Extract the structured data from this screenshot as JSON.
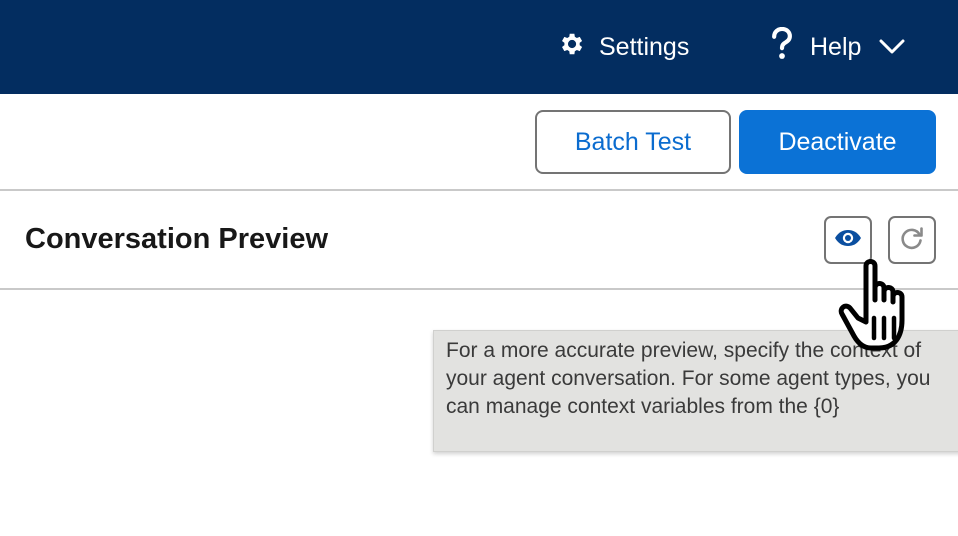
{
  "topbar": {
    "settings_icon": "gear-icon",
    "settings_label": "Settings",
    "help_icon": "question-icon",
    "help_label": "Help",
    "help_menu_icon": "chevron-down-icon"
  },
  "actions": {
    "batch_test_label": "Batch Test",
    "deactivate_label": "Deactivate"
  },
  "preview": {
    "title": "Conversation Preview",
    "context_icon": "eye-icon",
    "refresh_icon": "refresh-icon"
  },
  "tooltip": {
    "text": "For a more accurate preview, specify the context of your agent conversation. For some agent types, you can manage context variables from the {0}"
  },
  "colors": {
    "topbar_bg": "#032d60",
    "primary_button": "#0b72d6",
    "link_text": "#0b6ccf",
    "eye_icon": "#0b4fa0"
  }
}
